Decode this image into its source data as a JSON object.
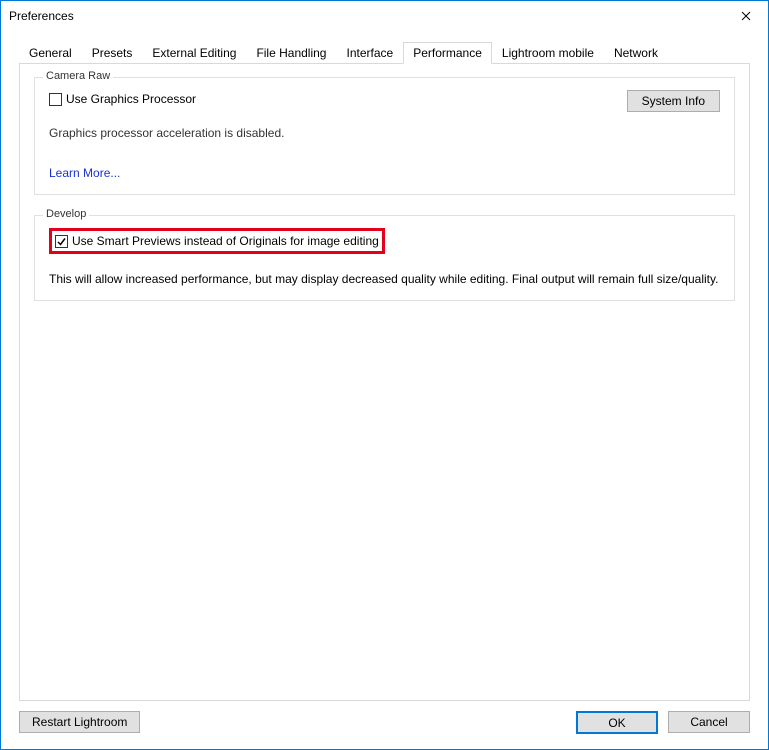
{
  "window": {
    "title": "Preferences"
  },
  "tabs": {
    "general": "General",
    "presets": "Presets",
    "external_editing": "External Editing",
    "file_handling": "File Handling",
    "interface": "Interface",
    "performance": "Performance",
    "lightroom_mobile": "Lightroom mobile",
    "network": "Network"
  },
  "camera_raw": {
    "legend": "Camera Raw",
    "use_gpu_label": "Use Graphics Processor",
    "status": "Graphics processor acceleration is disabled.",
    "learn_more": "Learn More...",
    "system_info": "System Info"
  },
  "develop": {
    "legend": "Develop",
    "smart_previews_label": "Use Smart Previews instead of Originals for image editing",
    "description": "This will allow increased performance, but may display decreased quality while editing. Final output will remain full size/quality."
  },
  "buttons": {
    "restart": "Restart Lightroom",
    "ok": "OK",
    "cancel": "Cancel"
  }
}
